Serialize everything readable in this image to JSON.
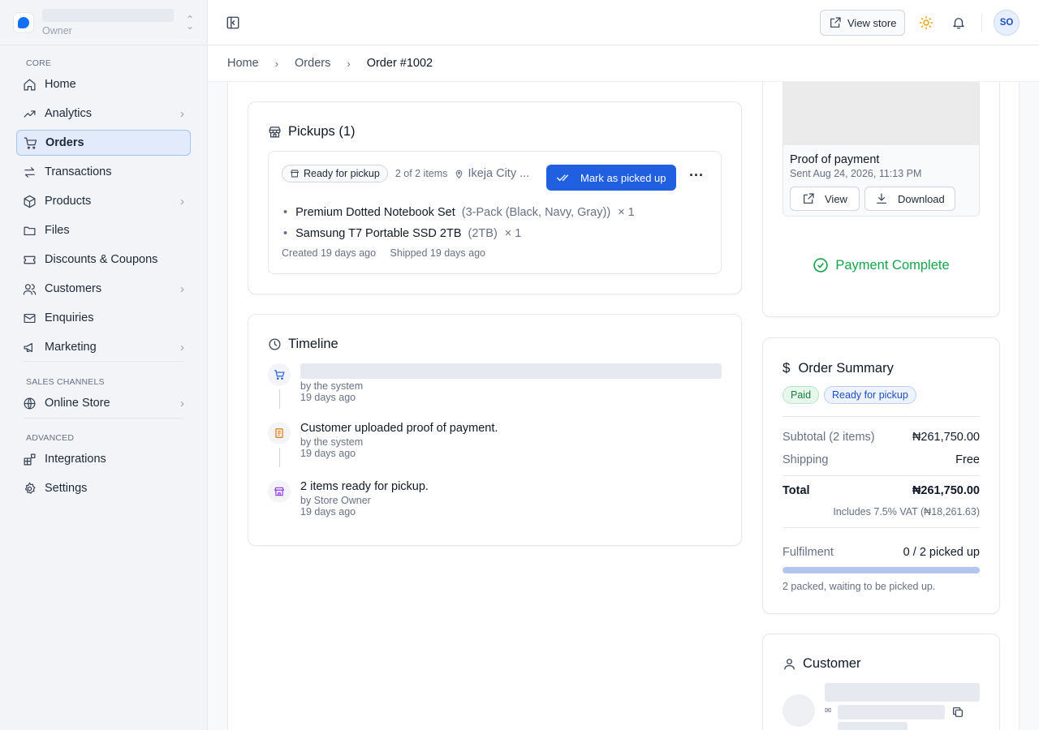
{
  "sidebar": {
    "role": "Owner",
    "sections": {
      "core": "CORE",
      "sales": "SALES CHANNELS",
      "advanced": "ADVANCED"
    },
    "items": [
      {
        "label": "Home"
      },
      {
        "label": "Analytics"
      },
      {
        "label": "Orders"
      },
      {
        "label": "Transactions"
      },
      {
        "label": "Products"
      },
      {
        "label": "Files"
      },
      {
        "label": "Discounts & Coupons"
      },
      {
        "label": "Customers"
      },
      {
        "label": "Enquiries"
      },
      {
        "label": "Marketing"
      },
      {
        "label": "Online Store"
      },
      {
        "label": "Integrations"
      },
      {
        "label": "Settings"
      }
    ]
  },
  "topbar": {
    "view_store": "View store",
    "avatar": "SO"
  },
  "breadcrumb": {
    "home": "Home",
    "orders": "Orders",
    "current": "Order #1002"
  },
  "pickups": {
    "title": "Pickups (1)",
    "status": "Ready for pickup",
    "count": "2 of 2 items",
    "location": "Ikeja City ...",
    "action": "Mark as picked up",
    "items": [
      {
        "name": "Premium Dotted Notebook Set",
        "variant": "(3-Pack (Black, Navy, Gray))",
        "qty": "× 1"
      },
      {
        "name": "Samsung T7 Portable SSD 2TB",
        "variant": "(2TB)",
        "qty": "× 1"
      }
    ],
    "created": "Created 19 days ago",
    "shipped": "Shipped 19 days ago"
  },
  "timeline": {
    "title": "Timeline",
    "events": [
      {
        "text": "",
        "by": "by the system",
        "when": "19 days ago"
      },
      {
        "text": "Customer uploaded proof of payment.",
        "by": "by the system",
        "when": "19 days ago"
      },
      {
        "text": "2 items ready for pickup.",
        "by": "by Store Owner",
        "when": "19 days ago"
      }
    ]
  },
  "payment": {
    "proof_title": "Proof of payment",
    "sent": "Sent Aug 24, 2026, 11:13 PM",
    "view": "View",
    "download": "Download",
    "status": "Payment Complete"
  },
  "summary": {
    "title": "Order Summary",
    "badges": [
      "Paid",
      "Ready for pickup"
    ],
    "subtotal_label": "Subtotal (2 items)",
    "subtotal": "₦261,750.00",
    "shipping_label": "Shipping",
    "shipping": "Free",
    "total_label": "Total",
    "total": "₦261,750.00",
    "vat": "Includes 7.5% VAT (₦18,261.63)",
    "fulfilment_label": "Fulfilment",
    "fulfilment": "0 / 2 picked up",
    "fulfilment_progress": 0,
    "fulfilment_note": "2 packed, waiting to be picked up."
  },
  "customer": {
    "title": "Customer"
  },
  "colors": {
    "primary": "#1f5fe0",
    "success": "#16a34a",
    "purple": "#9333ea",
    "amber": "#d97706"
  }
}
